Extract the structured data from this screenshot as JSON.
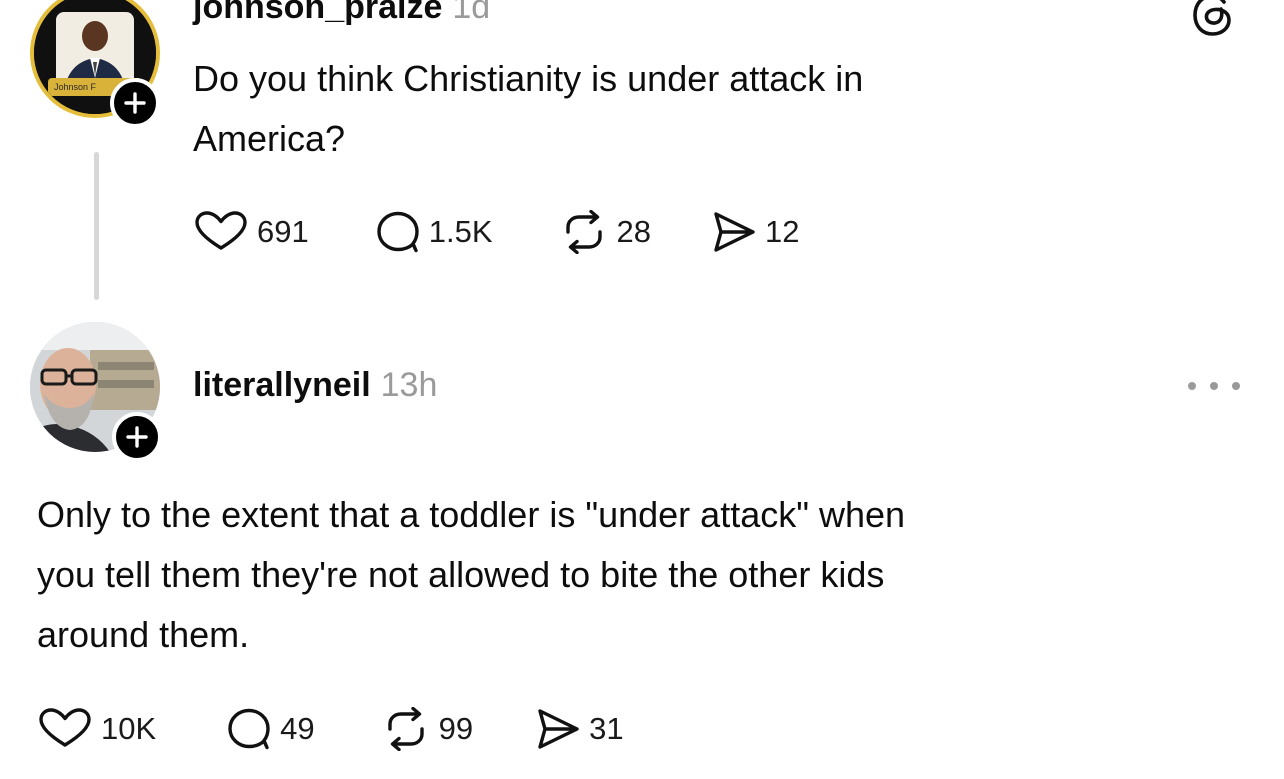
{
  "posts": [
    {
      "username": "johnson_praize",
      "time": "1d",
      "avatar_caption": "Johnson F",
      "text_lines": [
        "Do you think Christianity is under attack in",
        "America?"
      ],
      "likes": "691",
      "replies": "1.5K",
      "reposts": "28",
      "shares": "12"
    },
    {
      "username": "literallyneil",
      "time": "13h",
      "text_lines": [
        "Only to the extent that a toddler is \"under attack\" when",
        "you tell them they're not allowed to bite the other kids",
        "around them."
      ],
      "likes": "10K",
      "replies": "49",
      "reposts": "99",
      "shares": "31"
    }
  ],
  "icons": {
    "like": "heart-icon",
    "reply": "comment-icon",
    "repost": "repost-icon",
    "share": "send-icon",
    "follow": "plus-icon",
    "brand": "threads-logo-icon",
    "more": "more-icon"
  },
  "colors": {
    "text": "#0d0d0d",
    "muted": "#9a9a9a",
    "thread_line": "#d7d7d7",
    "avatar_ring": "#e4be3a"
  }
}
